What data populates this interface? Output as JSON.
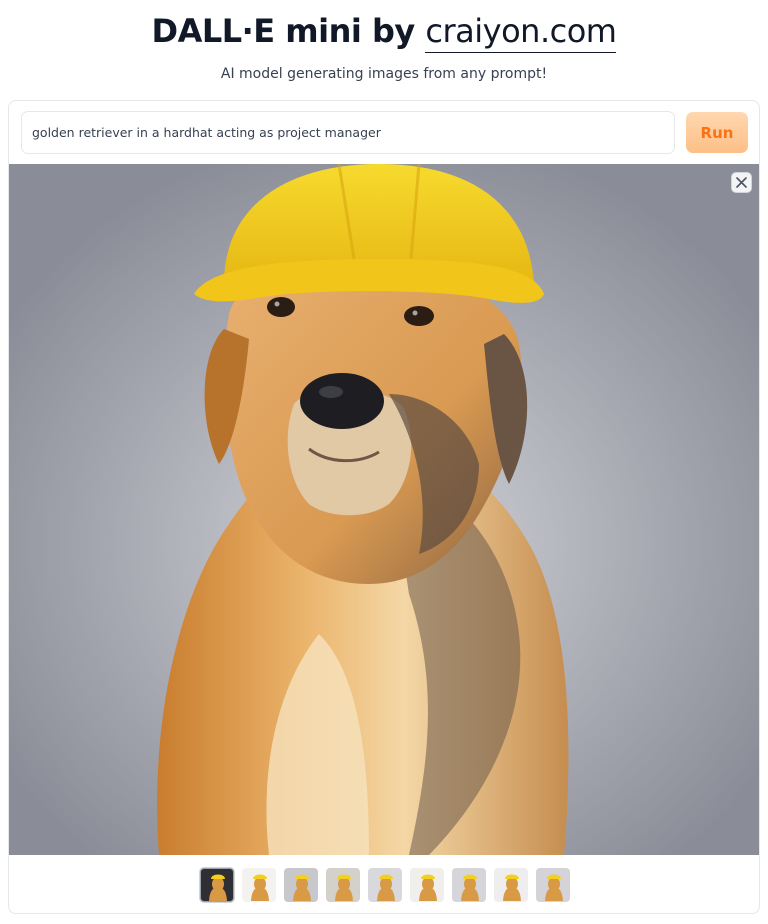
{
  "header": {
    "title_prefix": "DALL·E mini by ",
    "title_link": "craiyon.com",
    "subtitle": "AI model generating images from any prompt!"
  },
  "prompt": {
    "value": "golden retriever in a hardhat acting as project manager"
  },
  "run_button": {
    "label": "Run"
  },
  "viewer": {
    "close_icon": "close-icon",
    "selected_index": 0
  },
  "thumbnails": [
    {
      "index": 0,
      "background": "#2e2e33"
    },
    {
      "index": 1,
      "background": "#f3f2ee"
    },
    {
      "index": 2,
      "background": "#c8c8cc"
    },
    {
      "index": 3,
      "background": "#d4d1cb"
    },
    {
      "index": 4,
      "background": "#d9d9dd"
    },
    {
      "index": 5,
      "background": "#f0efec"
    },
    {
      "index": 6,
      "background": "#d6d6da"
    },
    {
      "index": 7,
      "background": "#eeeeee"
    },
    {
      "index": 8,
      "background": "#d3d3d8"
    }
  ],
  "colors": {
    "accent": "#f97316",
    "run_button_bg": "#fdbf86",
    "hardhat": "#f5cf1f",
    "dog_fur": "#d99a45"
  }
}
